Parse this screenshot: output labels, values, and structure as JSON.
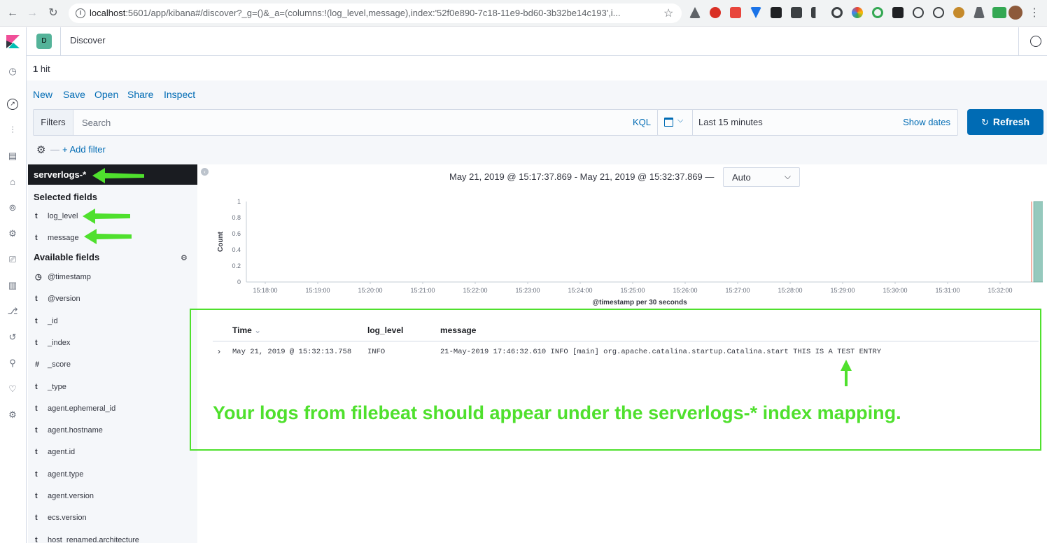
{
  "browser": {
    "url_host": "localhost",
    "url_rest": ":5601/app/kibana#/discover?_g=()&_a=(columns:!(log_level,message),index:'52f0e890-7c18-11e9-bd60-3b32be14c193',i..."
  },
  "header": {
    "app_badge": "D",
    "breadcrumb": "Discover"
  },
  "hits": {
    "count": "1",
    "label": "hit"
  },
  "top_menu": {
    "new": "New",
    "save": "Save",
    "open": "Open",
    "share": "Share",
    "inspect": "Inspect"
  },
  "query_bar": {
    "filters_label": "Filters",
    "search_placeholder": "Search",
    "language": "KQL"
  },
  "date_picker": {
    "label": "Last 15 minutes",
    "show_dates": "Show dates"
  },
  "refresh": {
    "label": "Refresh",
    "icon": "↻"
  },
  "filter_row": {
    "add_filter": "+ Add filter"
  },
  "sidebar": {
    "index_pattern": "serverlogs-*",
    "selected_title": "Selected fields",
    "selected_fields": [
      {
        "type": "t",
        "name": "log_level"
      },
      {
        "type": "t",
        "name": "message"
      }
    ],
    "available_title": "Available fields",
    "available_fields": [
      {
        "type": "◷",
        "name": "@timestamp"
      },
      {
        "type": "t",
        "name": "@version"
      },
      {
        "type": "t",
        "name": "_id"
      },
      {
        "type": "t",
        "name": "_index"
      },
      {
        "type": "#",
        "name": "_score"
      },
      {
        "type": "t",
        "name": "_type"
      },
      {
        "type": "t",
        "name": "agent.ephemeral_id"
      },
      {
        "type": "t",
        "name": "agent.hostname"
      },
      {
        "type": "t",
        "name": "agent.id"
      },
      {
        "type": "t",
        "name": "agent.type"
      },
      {
        "type": "t",
        "name": "agent.version"
      },
      {
        "type": "t",
        "name": "ecs.version"
      },
      {
        "type": "t",
        "name": "host_renamed.architecture"
      }
    ]
  },
  "chart": {
    "time_range": "May 21, 2019 @ 15:17:37.869 - May 21, 2019 @ 15:32:37.869 —",
    "interval": "Auto"
  },
  "chart_data": {
    "type": "bar",
    "ylabel": "Count",
    "xlabel": "@timestamp per 30 seconds",
    "ylim": [
      0,
      1
    ],
    "yticks": [
      "0",
      "0.2",
      "0.4",
      "0.6",
      "0.8",
      "1"
    ],
    "xticks": [
      "15:18:00",
      "15:19:00",
      "15:20:00",
      "15:21:00",
      "15:22:00",
      "15:23:00",
      "15:24:00",
      "15:25:00",
      "15:26:00",
      "15:27:00",
      "15:28:00",
      "15:29:00",
      "15:30:00",
      "15:31:00",
      "15:32:00"
    ],
    "bars": [
      {
        "x": "15:32:00",
        "value": 1
      }
    ],
    "bar_color": "#96c9bd"
  },
  "table": {
    "columns": [
      "Time",
      "log_level",
      "message"
    ],
    "rows": [
      {
        "time": "May 21, 2019 @ 15:32:13.758",
        "log_level": "INFO",
        "message": "21-May-2019 17:46:32.610 INFO [main] org.apache.catalina.startup.Catalina.start THIS IS A TEST ENTRY"
      }
    ]
  },
  "annotation": {
    "text": "Your logs from filebeat should appear under the serverlogs-* index mapping.",
    "color": "#4fe02d"
  },
  "colors": {
    "link": "#006bb4",
    "primary_button": "#006bb4",
    "sidebar_bg": "#f5f7fa",
    "index_header_bg": "#1a1c21"
  }
}
